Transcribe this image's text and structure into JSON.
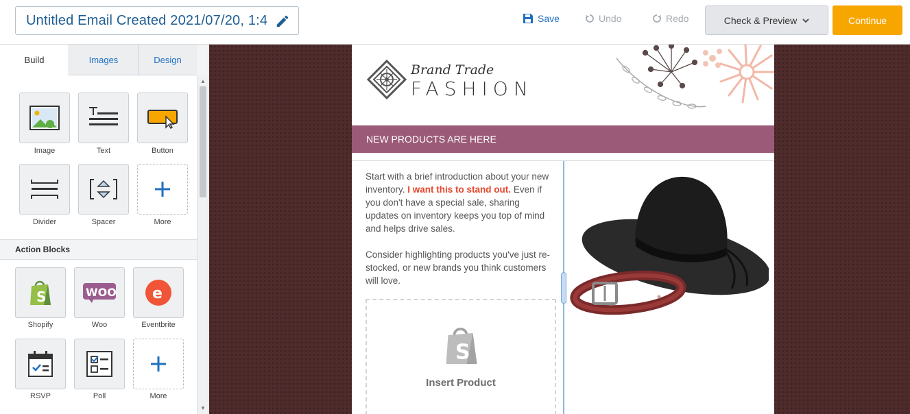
{
  "topbar": {
    "title": "Untitled Email Created 2021/07/20, 1:4",
    "save": "Save",
    "undo": "Undo",
    "redo": "Redo",
    "check_preview": "Check & Preview",
    "continue": "Continue"
  },
  "sidebar": {
    "tabs": [
      "Build",
      "Images",
      "Design"
    ],
    "active_tab": "Build",
    "blocks": [
      {
        "label": "Image",
        "icon": "image-icon"
      },
      {
        "label": "Text",
        "icon": "text-icon"
      },
      {
        "label": "Button",
        "icon": "button-icon"
      },
      {
        "label": "Divider",
        "icon": "divider-icon"
      },
      {
        "label": "Spacer",
        "icon": "spacer-icon"
      },
      {
        "label": "More",
        "icon": "plus-icon"
      }
    ],
    "action_section": "Action Blocks",
    "action_blocks": [
      {
        "label": "Shopify",
        "icon": "shopify-icon"
      },
      {
        "label": "Woo",
        "icon": "woo-icon"
      },
      {
        "label": "Eventbrite",
        "icon": "eventbrite-icon"
      },
      {
        "label": "RSVP",
        "icon": "rsvp-calendar-icon"
      },
      {
        "label": "Poll",
        "icon": "poll-icon"
      },
      {
        "label": "More",
        "icon": "plus-icon"
      }
    ]
  },
  "email": {
    "brand_script": "Brand Trade",
    "brand_main": "FASHION",
    "banner": "NEW PRODUCTS ARE HERE",
    "para1_a": "Start with a brief introduction about your new inventory.",
    "para1_highlight": "I want this to stand out.",
    "para1_b": "Even if you don't have a special sale, sharing updates on inventory keeps you top of mind and helps drive sales.",
    "para2": "Consider highlighting products you've just re-stocked, or new brands you think customers will love.",
    "insert_product": "Insert Product"
  },
  "colors": {
    "accent_blue": "#1f6fbf",
    "continue_orange": "#f7a600",
    "banner_mauve": "#9b5b78",
    "canvas_bg": "#4f2b2c",
    "highlight_red": "#e8452c"
  }
}
